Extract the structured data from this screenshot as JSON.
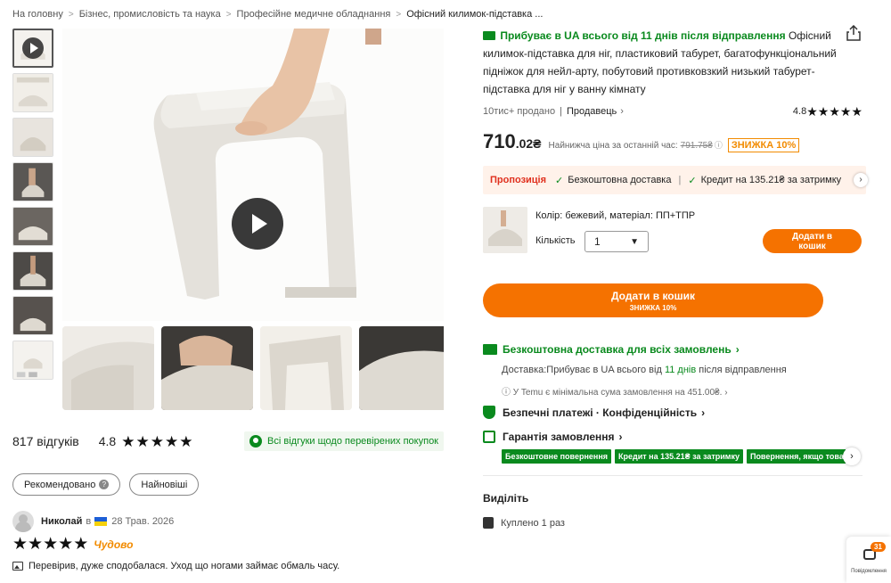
{
  "breadcrumb": {
    "items": [
      "На головну",
      "Бізнес, промисловість та наука",
      "Професійне медичне обладнання",
      "Офісний килимок-підставка ..."
    ]
  },
  "gallery": {
    "thumb_icons": [
      "play-icon"
    ]
  },
  "reviews": {
    "count": "817 відгуків",
    "rating": "4.8",
    "verified": "Всі відгуки щодо перевірених покупок",
    "sort_recommended": "Рекомендовано",
    "sort_newest": "Найновіші",
    "reviewer_name": "Николай",
    "reviewer_in": "в",
    "review_date": "28 Трав. 2026",
    "review_badge": "Чудово",
    "review_text": "Перевірив, дуже сподобалася. Уход що ногами займає обмаль часу."
  },
  "product": {
    "arrival": "Прибуває в UA всього від  11 днів після відправлення",
    "title": "Офісний килимок-підставка для ніг, пластиковий табурет, багатофункціональний підніжок для нейл-арту, побутовий противковзкий низький табурет-підставка для ніг у ванну кімнату",
    "sold": "10тис+ продано",
    "seller": "Продавець",
    "rating": "4.8",
    "price_main": "710",
    "price_cents": ".02₴",
    "price_note": "Найнижча ціна за останній час:",
    "price_old": "791.75₴",
    "discount": "ЗНИЖКА 10%",
    "promo_tag": "Пропозиція",
    "promo_free_shipping": "Безкоштовна доставка",
    "promo_credit": "Кредит на 135.21₴ за затримку",
    "variant": "Колір: бежевий, матеріал: ПП+ТПР",
    "qty_label": "Кількість",
    "qty_value": "1",
    "small_cart_l1": "Додати в",
    "small_cart_l2": "кошик",
    "cart_l1": "Додати в кошик",
    "cart_l2": "ЗНИЖКА 10%"
  },
  "shipping": {
    "title": "Безкоштовна доставка для всіх замовлень",
    "line1_prefix": "Доставка:",
    "line1_mid": "Прибуває в UA всього від ",
    "line1_days": "11 днів",
    "line1_suffix": " після відправлення",
    "line2": "ⓘ У Temu є мінімальна сума замовлення на 451.00₴."
  },
  "secure": {
    "label": "Безпечні платежі · Конфіденційність"
  },
  "guarantee": {
    "label": "Гарантія замовлення",
    "chips": [
      "Безкоштовне повернення",
      "Кредит на 135.21₴ за затримку",
      "Повернення, якщо товар пошкоджено"
    ]
  },
  "highlight": {
    "title": "Виділіть",
    "bought": "Куплено 1 раз"
  },
  "messages": {
    "count": "31",
    "label": "Повідомлення"
  },
  "colors": {
    "accent": "#f57200",
    "green": "#0a8a1e",
    "promo_bg": "#fff2ea"
  }
}
